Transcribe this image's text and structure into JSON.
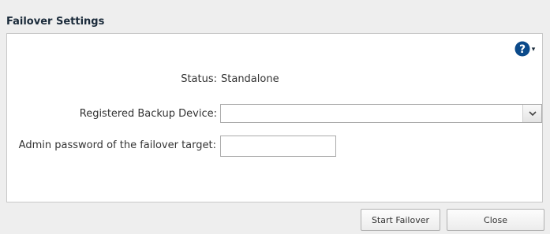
{
  "dialog": {
    "title": "Failover Settings",
    "help_icon": "help-circle-icon",
    "colors": {
      "help_icon": "#0b4a8a",
      "title": "#1a2a3a"
    }
  },
  "form": {
    "status_label": "Status:",
    "status_value": "Standalone",
    "backup_device_label": "Registered Backup Device:",
    "backup_device_value": "",
    "admin_password_label": "Admin password of the failover target:",
    "admin_password_value": ""
  },
  "footer": {
    "start_failover_label": "Start Failover",
    "close_label": "Close"
  }
}
